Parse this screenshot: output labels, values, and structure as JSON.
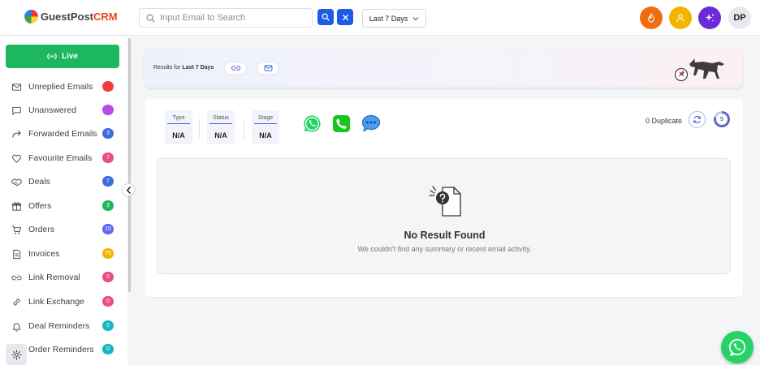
{
  "app": {
    "logo_prefix": "GuestPost",
    "logo_suffix": "CRM",
    "avatar_initials": "DP"
  },
  "header": {
    "search_placeholder": "Input Email to Search",
    "date_range": "Last 7 Days"
  },
  "sidebar": {
    "live_label": "Live",
    "items": [
      {
        "label": "Unreplied Emails",
        "badge": "",
        "badge_color": "#f03e3e",
        "icon": "mail-icon"
      },
      {
        "label": "Unanswered",
        "badge": "",
        "badge_color": "#b84ce6",
        "icon": "message-square-icon"
      },
      {
        "label": "Forwarded Emails",
        "badge": "3",
        "badge_color": "#3b6fe0",
        "icon": "forward-arrow-icon"
      },
      {
        "label": "Favourite Emails",
        "badge": "7",
        "badge_color": "#ea4c89",
        "icon": "heart-icon"
      },
      {
        "label": "Deals",
        "badge": "7",
        "badge_color": "#3b6fe0",
        "icon": "handshake-icon"
      },
      {
        "label": "Offers",
        "badge": "3",
        "badge_color": "#1cb75e",
        "icon": "gift-icon"
      },
      {
        "label": "Orders",
        "badge": "15",
        "badge_color": "#6366f1",
        "icon": "cart-icon"
      },
      {
        "label": "Invoices",
        "badge": "75",
        "badge_color": "#f0b400",
        "icon": "invoice-icon"
      },
      {
        "label": "Link Removal",
        "badge": "0",
        "badge_color": "#ea4c89",
        "icon": "unlink-icon"
      },
      {
        "label": "Link Exchange",
        "badge": "0",
        "badge_color": "#ea4c89",
        "icon": "link-icon"
      },
      {
        "label": "Deal Reminders",
        "badge": "0",
        "badge_color": "#14b8c4",
        "icon": "bell-icon"
      },
      {
        "label": "Order Reminders",
        "badge": "0",
        "badge_color": "#14b8c4",
        "icon": "bell-icon"
      }
    ]
  },
  "banner": {
    "prefix": "Results for",
    "range": "Last 7 Days"
  },
  "stats": [
    {
      "label": "Type",
      "value": "N/A"
    },
    {
      "label": "Status",
      "value": "N/A"
    },
    {
      "label": "Stage",
      "value": "N/A"
    }
  ],
  "summary": {
    "duplicate_text": "0 Duplicate",
    "count": "5"
  },
  "empty_state": {
    "title": "No Result Found",
    "subtitle": "We couldn't find any summary or recent email activity."
  },
  "colors": {
    "primary": "#1e5be6",
    "live_green": "#1cb75e",
    "orange": "#f06d0e",
    "yellow": "#f2b400",
    "purple": "#6b2bd9"
  }
}
